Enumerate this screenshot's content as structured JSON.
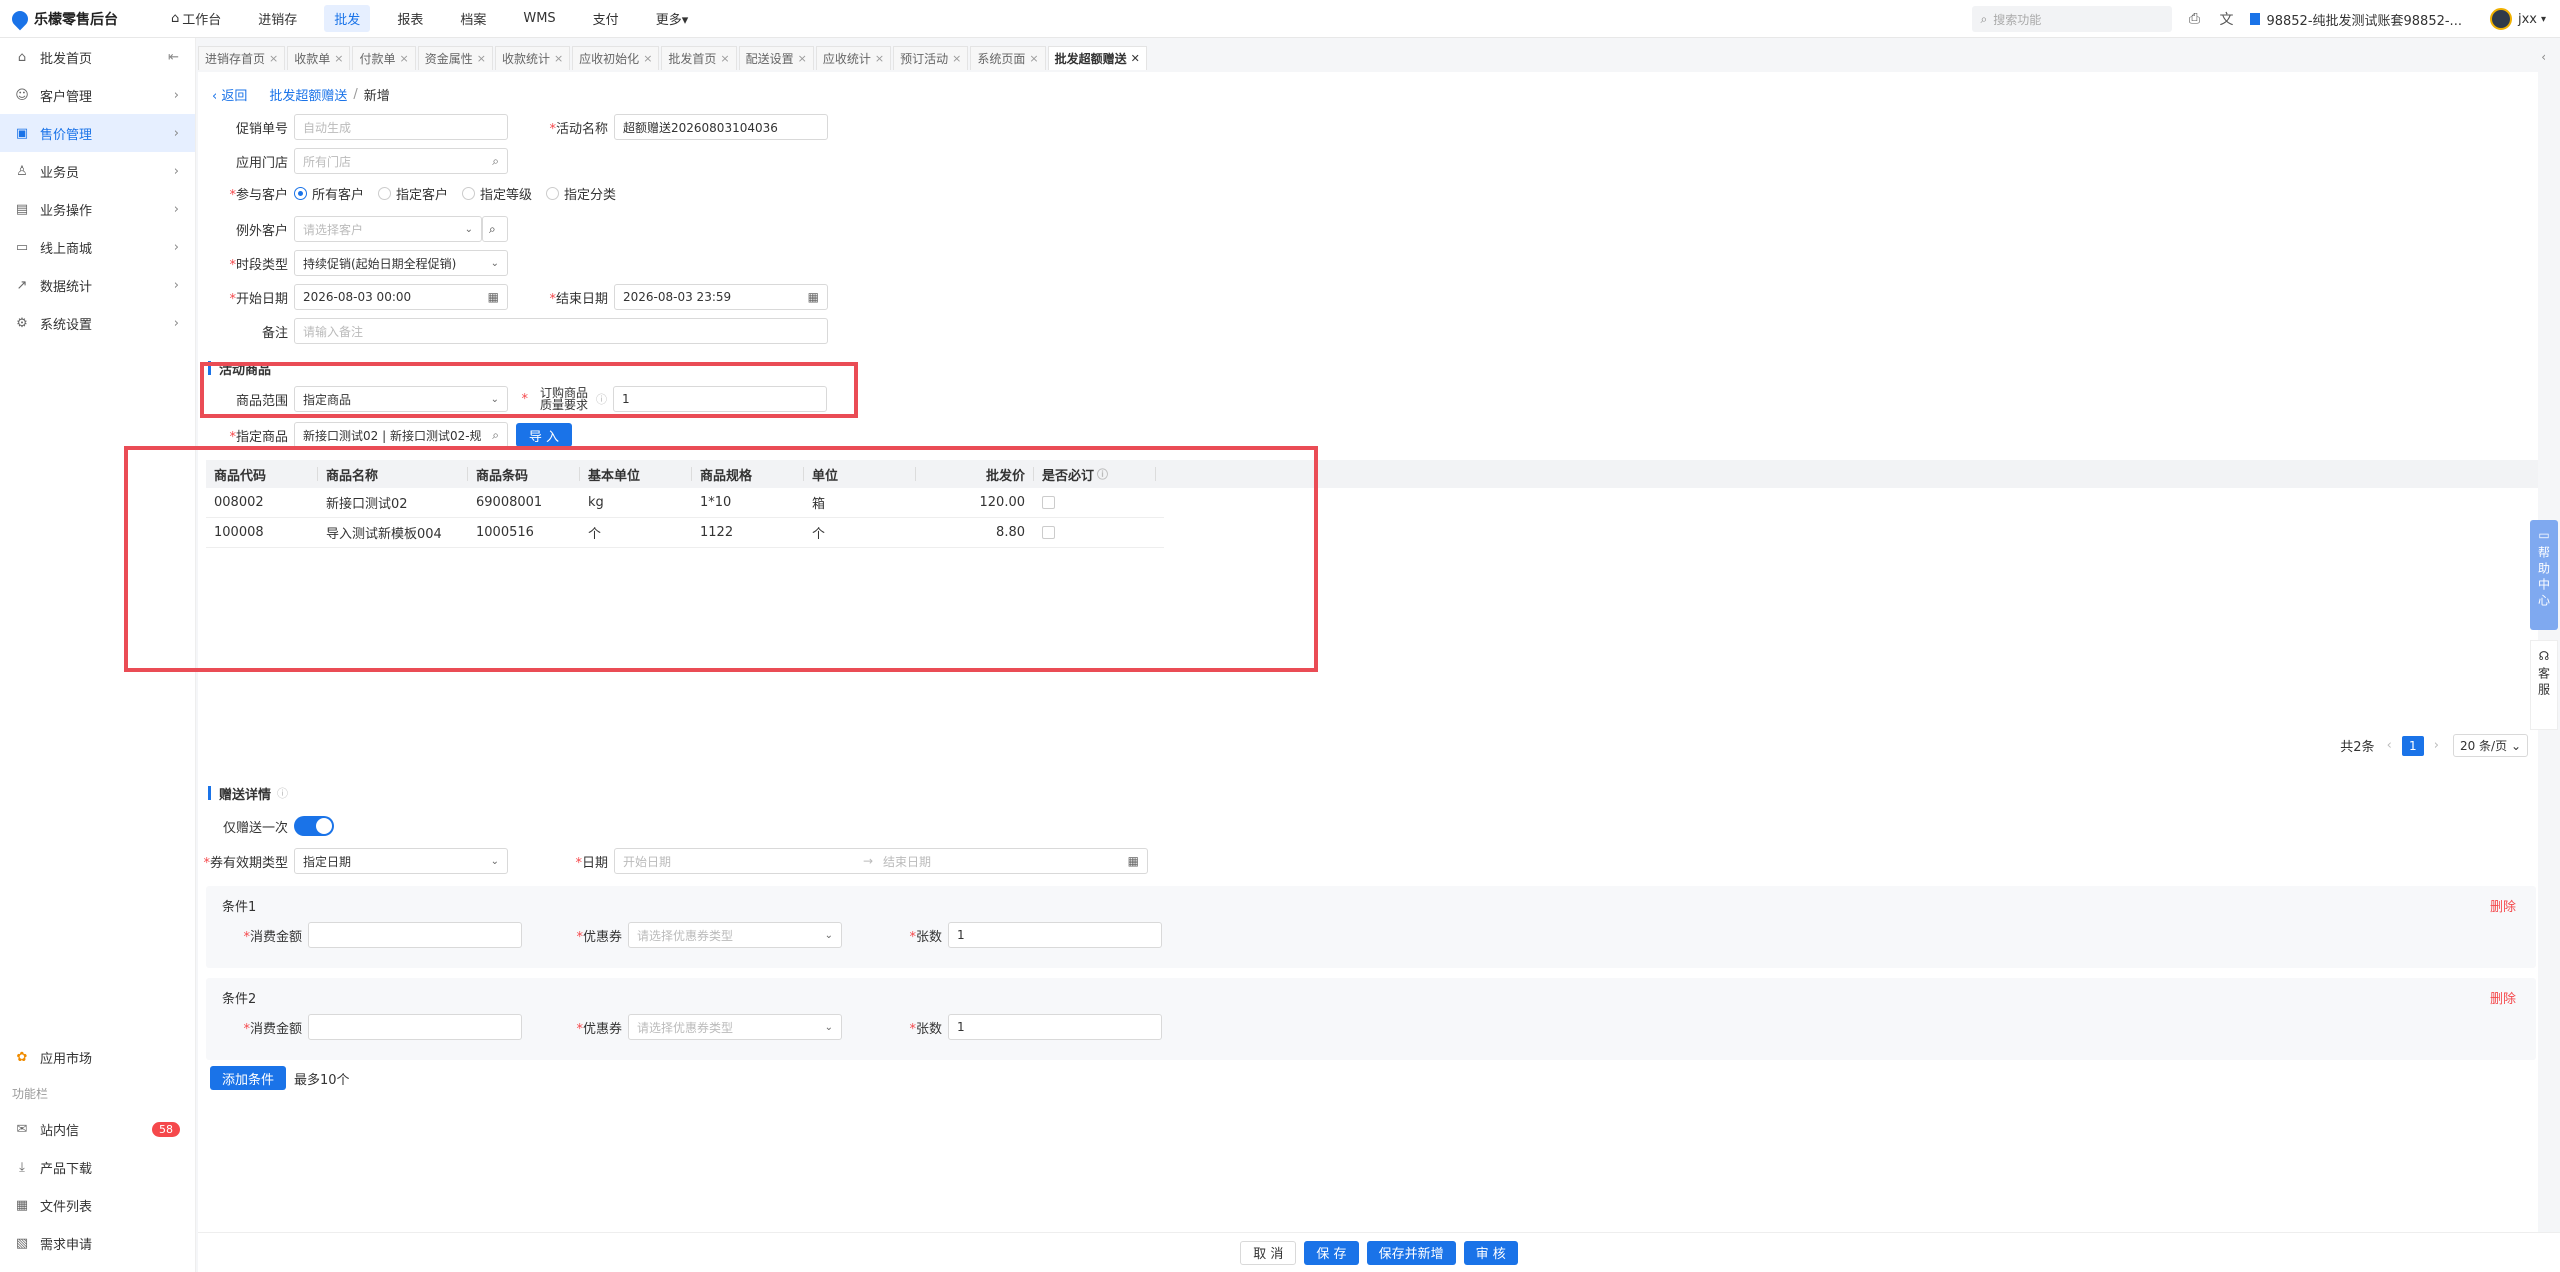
{
  "app": {
    "title": "乐檬零售后台"
  },
  "topnav": [
    {
      "label": "工作台",
      "icon": "home-icon"
    },
    {
      "label": "进销存"
    },
    {
      "label": "批发",
      "active": true
    },
    {
      "label": "报表"
    },
    {
      "label": "档案"
    },
    {
      "label": "WMS"
    },
    {
      "label": "支付"
    },
    {
      "label": "更多▾"
    }
  ],
  "search": {
    "placeholder": "搜索功能"
  },
  "account": "98852-纯批发测试账套98852-...",
  "user": "jxx",
  "sidebar": {
    "items": [
      {
        "label": "批发首页",
        "icon": "home-icon"
      },
      {
        "label": "客户管理",
        "icon": "user-icon"
      },
      {
        "label": "售价管理",
        "icon": "price-tag-icon",
        "active": true
      },
      {
        "label": "业务员",
        "icon": "person-icon"
      },
      {
        "label": "业务操作",
        "icon": "briefcase-icon"
      },
      {
        "label": "线上商城",
        "icon": "shop-icon"
      },
      {
        "label": "数据统计",
        "icon": "chart-icon"
      },
      {
        "label": "系统设置",
        "icon": "gear-icon"
      }
    ],
    "app_market": "应用市场",
    "section": "功能栏",
    "func_items": [
      {
        "label": "站内信",
        "badge": "58"
      },
      {
        "label": "产品下载"
      },
      {
        "label": "文件列表"
      },
      {
        "label": "需求申请"
      }
    ]
  },
  "tabs": [
    {
      "label": "进销存首页"
    },
    {
      "label": "收款单"
    },
    {
      "label": "付款单"
    },
    {
      "label": "资金属性"
    },
    {
      "label": "收款统计"
    },
    {
      "label": "应收初始化"
    },
    {
      "label": "批发首页"
    },
    {
      "label": "配送设置"
    },
    {
      "label": "应收统计"
    },
    {
      "label": "预订活动"
    },
    {
      "label": "系统页面"
    },
    {
      "label": "批发超额赠送",
      "active": true
    }
  ],
  "breadcrumb": {
    "back": "返回",
    "parent": "批发超额赠送",
    "sep": "/",
    "current": "新增"
  },
  "form": {
    "promo_no": {
      "label": "促销单号",
      "placeholder": "自动生成"
    },
    "activity_name": {
      "label": "活动名称",
      "value": "超额赠送20260803104036"
    },
    "store": {
      "label": "应用门店",
      "placeholder": "所有门店"
    },
    "customer": {
      "label": "参与客户",
      "options": [
        "所有客户",
        "指定客户",
        "指定等级",
        "指定分类"
      ]
    },
    "exclude": {
      "label": "例外客户",
      "placeholder": "请选择客户"
    },
    "period_type": {
      "label": "时段类型",
      "value": "持续促销(起始日期全程促销)"
    },
    "start_date": {
      "label": "开始日期",
      "value": "2026-08-03 00:00"
    },
    "end_date": {
      "label": "结束日期",
      "value": "2026-08-03 23:59"
    },
    "remark": {
      "label": "备注",
      "placeholder": "请输入备注"
    }
  },
  "goods_section": {
    "title": "活动商品"
  },
  "goods": {
    "range": {
      "label": "商品范围",
      "value": "指定商品"
    },
    "order_req": {
      "label1": "订购商品",
      "label2": "质量要求",
      "value": "1"
    },
    "specified": {
      "label": "指定商品",
      "value": "新接口测试02 | 新接口测试02-规"
    },
    "import_btn": "导 入"
  },
  "table": {
    "headers": [
      "商品代码",
      "商品名称",
      "商品条码",
      "基本单位",
      "商品规格",
      "单位",
      "批发价",
      "是否必订"
    ],
    "rows": [
      [
        "008002",
        "新接口测试02",
        "69008001",
        "kg",
        "1*10",
        "箱",
        "120.00"
      ],
      [
        "100008",
        "导入测试新模板004",
        "1000516",
        "个",
        "1122",
        "个",
        "8.80"
      ]
    ]
  },
  "pager": {
    "total": "共2条",
    "page": "1",
    "size": "20 条/页"
  },
  "gift_section": {
    "title": "赠送详情"
  },
  "gift": {
    "once_label": "仅赠送一次",
    "coupon_type": {
      "label": "券有效期类型",
      "value": "指定日期"
    },
    "date": {
      "label": "日期",
      "start_placeholder": "开始日期",
      "arrow": "→",
      "end_placeholder": "结束日期"
    }
  },
  "conditions": [
    {
      "title": "条件1",
      "delete": "删除",
      "amount_label": "消费金额",
      "coupon_label": "优惠券",
      "coupon_placeholder": "请选择优惠券类型",
      "count_label": "张数",
      "count_value": "1"
    },
    {
      "title": "条件2",
      "delete": "删除",
      "amount_label": "消费金额",
      "coupon_label": "优惠券",
      "coupon_placeholder": "请选择优惠券类型",
      "count_label": "张数",
      "count_value": "1"
    }
  ],
  "add_condition": {
    "label": "添加条件",
    "hint": "最多10个"
  },
  "footer": {
    "cancel": "取 消",
    "save": "保 存",
    "save_new": "保存并新增",
    "audit": "审 核"
  },
  "float": {
    "help": "帮助中心",
    "cs": "客服"
  }
}
